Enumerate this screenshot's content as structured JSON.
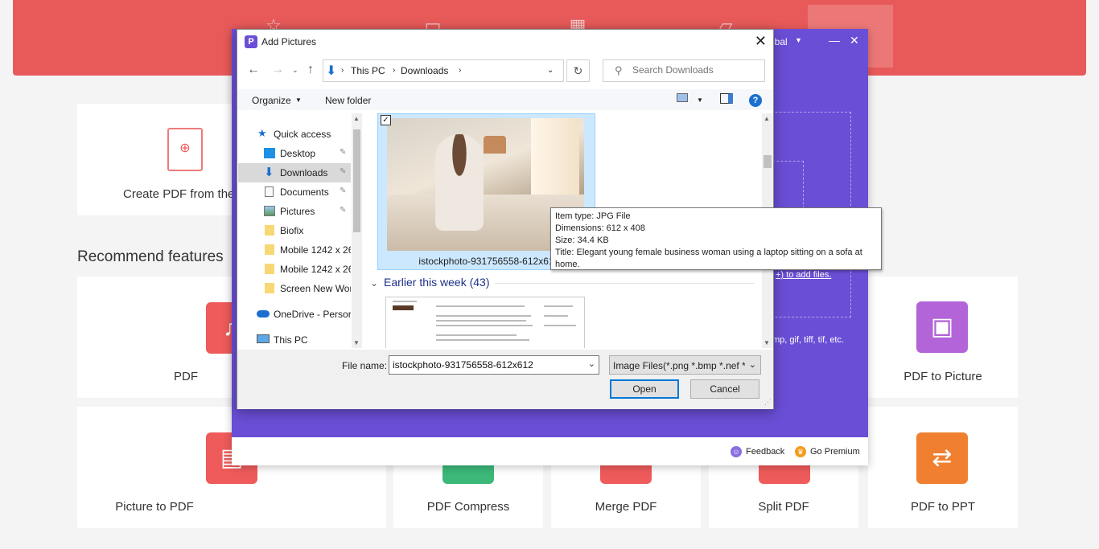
{
  "app": {
    "create_card_label": "Create PDF from the",
    "section_title": "Recommend features",
    "features_row1": [
      {
        "label": "PDF",
        "icon": "pdf-to-word-icon",
        "color": "#ef5b5b"
      },
      {
        "label": "PDF to Picture",
        "icon": "pdf-to-picture-icon",
        "color": "#b264d8"
      }
    ],
    "features_row2": [
      {
        "label": "Picture to PDF",
        "icon": "picture-to-pdf-icon",
        "color": "#ef5b5b"
      },
      {
        "label": "PDF Compress",
        "icon": "compress-icon",
        "color": "#3cb878"
      },
      {
        "label": "Merge PDF",
        "icon": "merge-icon",
        "color": "#ef5b5b"
      },
      {
        "label": "Split PDF",
        "icon": "split-icon",
        "color": "#ef5b5b"
      },
      {
        "label": "PDF to PPT",
        "icon": "pdf-to-ppt-icon",
        "color": "#f08030"
      }
    ],
    "user_label": "qbal",
    "add_files_link": "+) to add files.",
    "formats_text": "mp, gif, tiff, tif, etc.",
    "feedback_label": "Feedback",
    "premium_label": "Go Premium",
    "colors": {
      "topbar": "#e85a5a",
      "app_purple": "#6a4ed6"
    }
  },
  "dialog": {
    "title": "Add Pictures",
    "breadcrumb": [
      "This PC",
      "Downloads"
    ],
    "search_placeholder": "Search Downloads",
    "toolbar": {
      "organize": "Organize",
      "new_folder": "New folder"
    },
    "nav_items": [
      {
        "label": "Quick access",
        "icon": "star-icon",
        "pinned": false
      },
      {
        "label": "Desktop",
        "icon": "desktop-icon",
        "pinned": true
      },
      {
        "label": "Downloads",
        "icon": "download-arrow-icon",
        "pinned": true,
        "selected": true
      },
      {
        "label": "Documents",
        "icon": "documents-icon",
        "pinned": true
      },
      {
        "label": "Pictures",
        "icon": "pictures-icon",
        "pinned": true
      },
      {
        "label": "Biofix",
        "icon": "folder-icon",
        "pinned": false
      },
      {
        "label": "Mobile 1242 x 26",
        "icon": "folder-icon",
        "pinned": false
      },
      {
        "label": "Mobile 1242 x 26",
        "icon": "folder-icon",
        "pinned": false
      },
      {
        "label": "Screen New Wor",
        "icon": "folder-icon",
        "pinned": false
      },
      {
        "label": "OneDrive - Persor",
        "icon": "onedrive-icon",
        "pinned": false
      },
      {
        "label": "This PC",
        "icon": "computer-icon",
        "pinned": false
      }
    ],
    "selected_file_name": "istockphoto-931756558-612x61",
    "group_header": "Earlier this week (43)",
    "tooltip": {
      "type": "Item type: JPG File",
      "dimensions": "Dimensions: 612 x 408",
      "size": "Size: 34.4 KB",
      "title": "Title: Elegant young female business woman using a laptop sitting on a sofa at home."
    },
    "file_name_label": "File name:",
    "file_name_value": "istockphoto-931756558-612x612",
    "file_type": "Image Files(*.png *.bmp *.nef *",
    "open_label": "Open",
    "cancel_label": "Cancel"
  }
}
